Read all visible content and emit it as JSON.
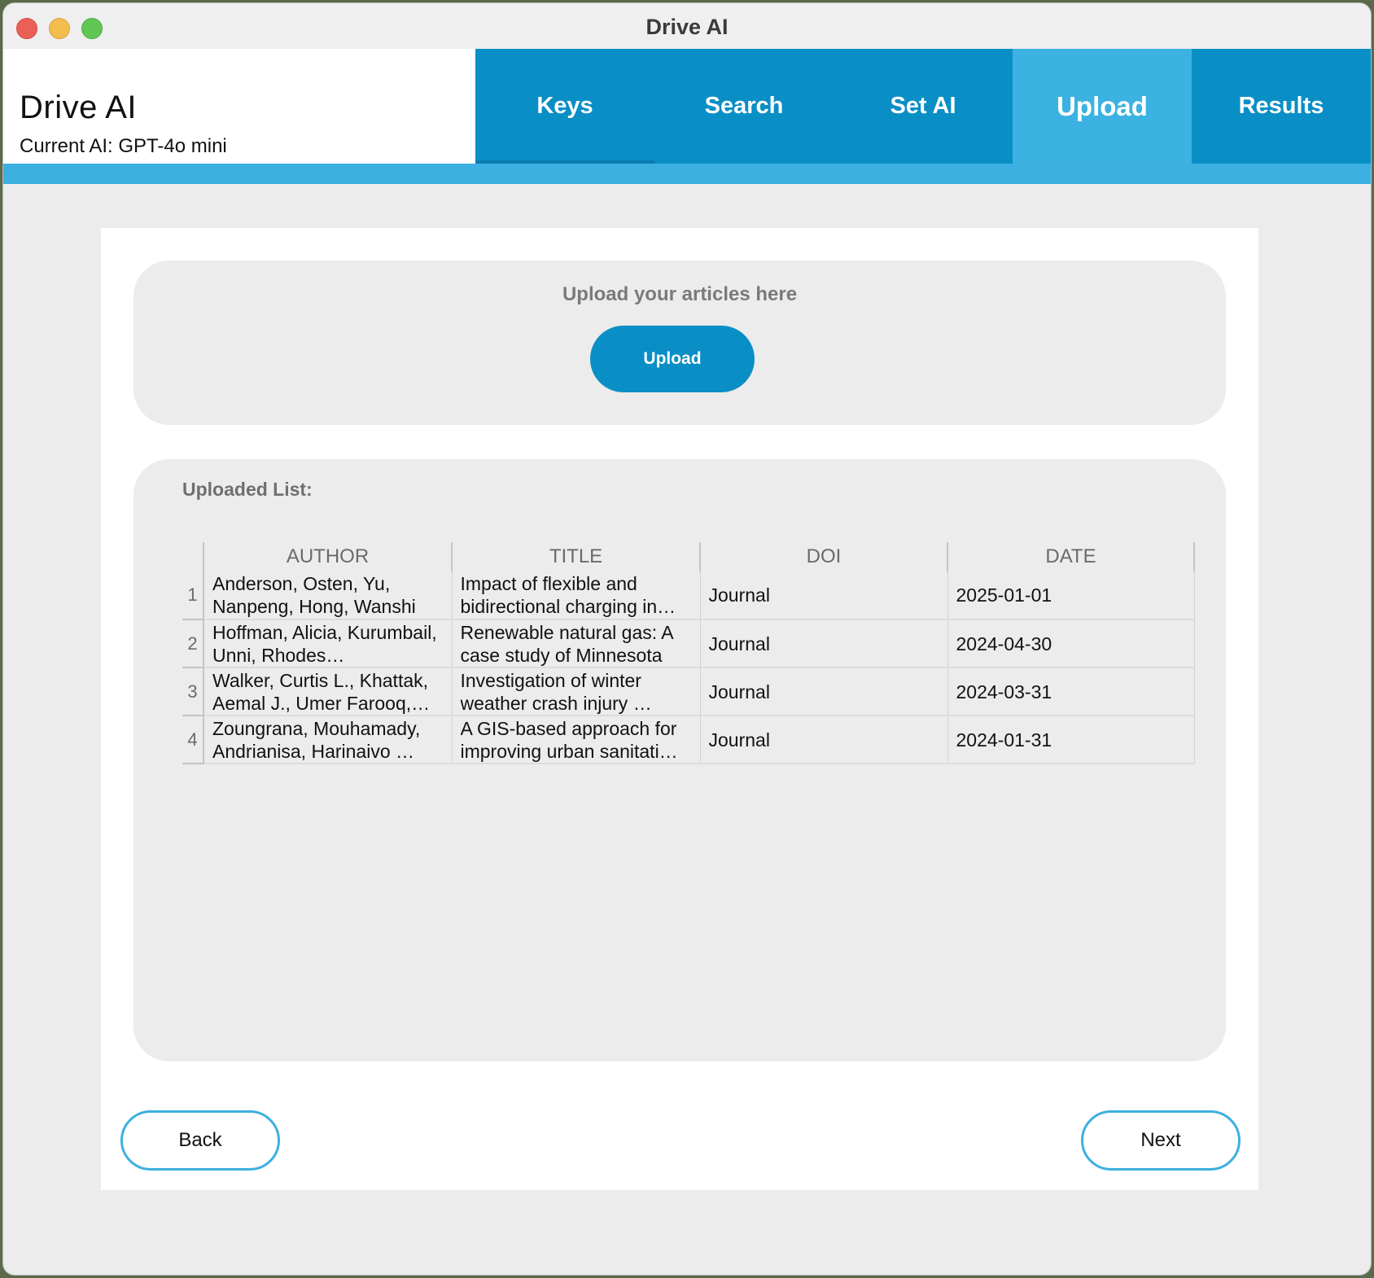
{
  "window": {
    "title": "Drive AI"
  },
  "header": {
    "app_title": "Drive AI",
    "current_ai": "Current AI: GPT-4o mini"
  },
  "tabs": [
    {
      "label": "Keys",
      "active": false
    },
    {
      "label": "Search",
      "active": false
    },
    {
      "label": "Set AI",
      "active": false
    },
    {
      "label": "Upload",
      "active": true
    },
    {
      "label": "Results",
      "active": false
    }
  ],
  "upload": {
    "prompt": "Upload your articles here",
    "button_label": "Upload"
  },
  "list": {
    "label": "Uploaded List:",
    "columns": [
      "AUTHOR",
      "TITLE",
      "DOI",
      "DATE"
    ],
    "rows": [
      {
        "index": "1",
        "author": "Anderson, Osten, Yu, Nanpeng, Hong, Wanshi",
        "title": "Impact of flexible and bidirectional charging in…",
        "doi": "Journal",
        "date": "2025-01-01"
      },
      {
        "index": "2",
        "author": "Hoffman, Alicia, Kurumbail, Unni, Rhodes…",
        "title": "Renewable natural gas: A case study of Minnesota",
        "doi": "Journal",
        "date": "2024-04-30"
      },
      {
        "index": "3",
        "author": "Walker, Curtis L., Khattak, Aemal J., Umer Farooq,…",
        "title": "Investigation of winter weather crash injury …",
        "doi": "Journal",
        "date": "2024-03-31"
      },
      {
        "index": "4",
        "author": "Zoungrana, Mouhamady, Andrianisa, Harinaivo …",
        "title": "A GIS-based approach for improving urban sanitati…",
        "doi": "Journal",
        "date": "2024-01-31"
      }
    ]
  },
  "nav": {
    "back_label": "Back",
    "next_label": "Next"
  },
  "colors": {
    "tab_bar": "#0a8ec6",
    "active_tab": "#3bb2e1",
    "accent": "#3cb0e0"
  }
}
